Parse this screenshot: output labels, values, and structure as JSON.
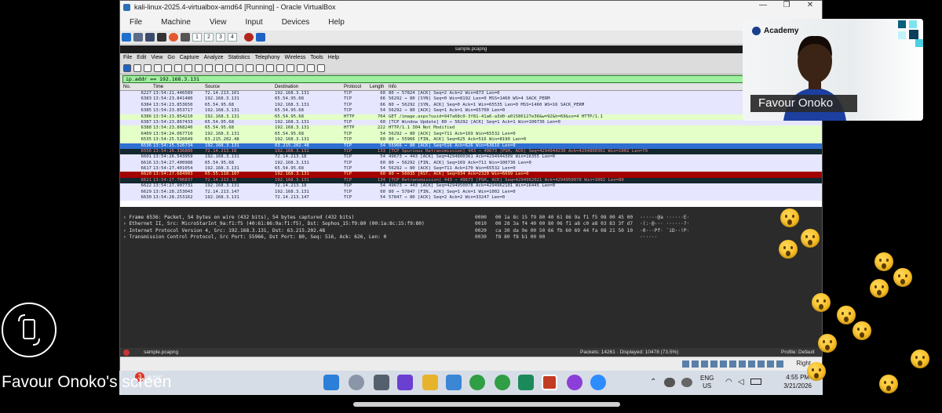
{
  "vbox": {
    "title": "kali-linux-2025.4-virtualbox-amd64 [Running] - Oracle VirtualBox",
    "menu": [
      "File",
      "Machine",
      "View",
      "Input",
      "Devices",
      "Help"
    ],
    "workspaces": [
      "1",
      "2",
      "3",
      "4"
    ]
  },
  "wireshark": {
    "window_title": "sample.pcapng",
    "menu": [
      "File",
      "Edit",
      "View",
      "Go",
      "Capture",
      "Analyze",
      "Statistics",
      "Telephony",
      "Wireless",
      "Tools",
      "Help"
    ],
    "filter": "ip.addr == 192.168.3.131",
    "columns": [
      "No.",
      "Time",
      "Source",
      "Destination",
      "Protocol",
      "Length",
      "Info"
    ],
    "packets": [
      {
        "no": "6227",
        "time": "13:54:21.446589",
        "src": "72.14.213.101",
        "dst": "192.168.3.131",
        "proto": "TCP",
        "len": "60",
        "info": "80 → 57824 [ACK] Seq=2 Ack=2 Win=873 Len=0",
        "style": "tcp"
      },
      {
        "no": "6383",
        "time": "13:54:23.841480",
        "src": "192.168.3.131",
        "dst": "65.54.95.68",
        "proto": "TCP",
        "len": "66",
        "info": "56292 → 80 [SYN] Seq=0 Win=8192 Len=0 MSS=1460 WS=4 SACK_PERM",
        "style": "tcp"
      },
      {
        "no": "6384",
        "time": "13:54:23.853650",
        "src": "65.54.95.68",
        "dst": "192.168.3.131",
        "proto": "TCP",
        "len": "66",
        "info": "80 → 56292 [SYN, ACK] Seq=0 Ack=1 Win=65535 Len=0 MSS=1460 WS=16 SACK_PERM",
        "style": "tcp"
      },
      {
        "no": "6385",
        "time": "13:54:23.853717",
        "src": "192.168.3.131",
        "dst": "65.54.95.68",
        "proto": "TCP",
        "len": "54",
        "info": "56292 → 80 [ACK] Seq=1 Ack=1 Win=65700 Len=0",
        "style": "tcp"
      },
      {
        "no": "6386",
        "time": "13:54:23.854210",
        "src": "192.168.3.131",
        "dst": "65.54.95.68",
        "proto": "HTTP",
        "len": "764",
        "info": "GET /image.aspx?uuid=947a68c0-3f81-41a6-a3d0-a01586127e36&w=92&h=69&so=4 HTTP/1.1",
        "style": "http"
      },
      {
        "no": "6387",
        "time": "13:54:23.867433",
        "src": "65.54.95.68",
        "dst": "192.168.3.131",
        "proto": "TCP",
        "len": "60",
        "info": "[TCP Window Update] 80 → 56292 [ACK] Seq=1 Ack=1 Win=100736 Len=0",
        "style": "tcp"
      },
      {
        "no": "6388",
        "time": "13:54:23.868240",
        "src": "65.54.95.68",
        "dst": "192.168.3.131",
        "proto": "HTTP",
        "len": "222",
        "info": "HTTP/1.1 304 Not Modified",
        "style": "http"
      },
      {
        "no": "6409",
        "time": "13:54:24.067710",
        "src": "192.168.3.131",
        "dst": "65.54.95.68",
        "proto": "TCP",
        "len": "54",
        "info": "56292 → 80 [ACK] Seq=711 Ack=169 Win=65532 Len=0",
        "style": "http"
      },
      {
        "no": "6535",
        "time": "13:54:25.526649",
        "src": "63.215.202.48",
        "dst": "192.168.3.131",
        "proto": "TCP",
        "len": "60",
        "info": "80 → 55966 [FIN, ACK] Seq=625 Ack=516 Win=8190 Len=0",
        "style": "http"
      },
      {
        "no": "6536",
        "time": "13:54:25.526734",
        "src": "192.168.3.131",
        "dst": "63.215.202.48",
        "proto": "TCP",
        "len": "54",
        "info": "55966 → 80 [ACK] Seq=516 Ack=626 Win=63616 Len=0",
        "style": "sel"
      },
      {
        "no": "6556",
        "time": "13:54:26.336800",
        "src": "72.14.213.18",
        "dst": "192.168.3.131",
        "proto": "TCP",
        "len": "133",
        "info": "[TCP Spurious Retransmission] 443 → 49673 [PSH, ACK] Seq=4294944230 Ack=4294800361 Win=1002 Len=79",
        "style": "rtx"
      },
      {
        "no": "6601",
        "time": "13:54:26.543959",
        "src": "192.168.3.131",
        "dst": "72.14.213.18",
        "proto": "TCP",
        "len": "54",
        "info": "49673 → 443 [ACK] Seq=4294800361 Ack=4294944309 Win=16355 Len=0",
        "style": "tcp"
      },
      {
        "no": "6616",
        "time": "13:54:27.400988",
        "src": "65.54.95.68",
        "dst": "192.168.3.131",
        "proto": "TCP",
        "len": "60",
        "info": "80 → 56292 [FIN, ACK] Seq=169 Ack=711 Win=100736 Len=0",
        "style": "tcp"
      },
      {
        "no": "6617",
        "time": "13:54:27.401054",
        "src": "192.168.3.131",
        "dst": "65.54.95.68",
        "proto": "TCP",
        "len": "54",
        "info": "56292 → 80 [ACK] Seq=711 Ack=170 Win=65532 Len=0",
        "style": "tcp"
      },
      {
        "no": "6620",
        "time": "13:54:27.684903",
        "src": "65.55.118.107",
        "dst": "192.168.3.131",
        "proto": "TCP",
        "len": "60",
        "info": "80 → 56035 [RST, ACK] Seq=934 Ack=2320 Win=6699 Len=0",
        "style": "rst"
      },
      {
        "no": "6621",
        "time": "13:54:27.706837",
        "src": "72.14.213.18",
        "dst": "192.168.3.131",
        "proto": "TCP",
        "len": "134",
        "info": "[TCP Retransmission] 443 → 49673 [PSH, ACK] Seq=4294962021 Ack=4294950078 Win=1002 Len=80",
        "style": "rtx"
      },
      {
        "no": "6622",
        "time": "13:54:27.907731",
        "src": "192.168.3.131",
        "dst": "72.14.213.18",
        "proto": "TCP",
        "len": "54",
        "info": "49673 → 443 [ACK] Seq=4294950078 Ack=4294962101 Win=16445 Len=0",
        "style": "tcp"
      },
      {
        "no": "6629",
        "time": "13:54:28.253043",
        "src": "72.14.213.147",
        "dst": "192.168.3.131",
        "proto": "TCP",
        "len": "60",
        "info": "80 → 57847 [FIN, ACK] Seq=1 Ack=1 Win=1002 Len=0",
        "style": "tcp"
      },
      {
        "no": "6630",
        "time": "13:54:28.253162",
        "src": "192.168.3.131",
        "dst": "72.14.213.147",
        "proto": "TCP",
        "len": "54",
        "info": "57847 → 80 [ACK] Seq=2 Ack=2 Win=33247 Len=0",
        "style": "tcp"
      }
    ],
    "details": [
      "› Frame 6536: Packet, 54 bytes on wire (432 bits), 54 bytes captured (432 bits)",
      "› Ethernet II, Src: MicroStarInt_9a:f1:f5 (40:61:86:9a:f1:f5), Dst: Sophos_15:f9:80 (00:1a:8c:15:f9:80)",
      "› Internet Protocol Version 4, Src: 192.168.3.131, Dst: 63.215.202.48",
      "› Transmission Control Protocol, Src Port: 55966, Dst Port: 80, Seq: 516, Ack: 626, Len: 0"
    ],
    "bytes": [
      {
        "off": "0000",
        "hex": "00 1a 8c 15 f9 80 40 61  86 9a f1 f5 08 00 45 00",
        "ascii": "······@a ······E·"
      },
      {
        "off": "0010",
        "hex": "00 28 3a f4 40 00 80 06  f1 a8 c0 a8 03 83 3f d7",
        "ascii": "·(:·@··· ······?·"
      },
      {
        "off": "0020",
        "hex": "ca 30 da 9e 00 50 66 fb  60 69 44 fa 08 21 50 10",
        "ascii": "·0···Pf· `iD··!P·"
      },
      {
        "off": "0030",
        "hex": "f8 80 f8 b1 00 00",
        "ascii": "······"
      }
    ],
    "status": {
      "file": "sample.pcapng",
      "packets": "Packets: 14261 · Displayed: 10478 (73.5%)",
      "profile": "Profile: Default"
    }
  },
  "overlay": {
    "academy": "Academy",
    "speaker": "Favour Onoko",
    "screen_label": "Favour Onoko's screen",
    "weather_temp": "87°F",
    "notif_count": "3",
    "host_key": "Right"
  },
  "taskbar": {
    "lang": "ENG",
    "region": "US",
    "time": "4:55 PM",
    "date": "3/21/2026"
  }
}
